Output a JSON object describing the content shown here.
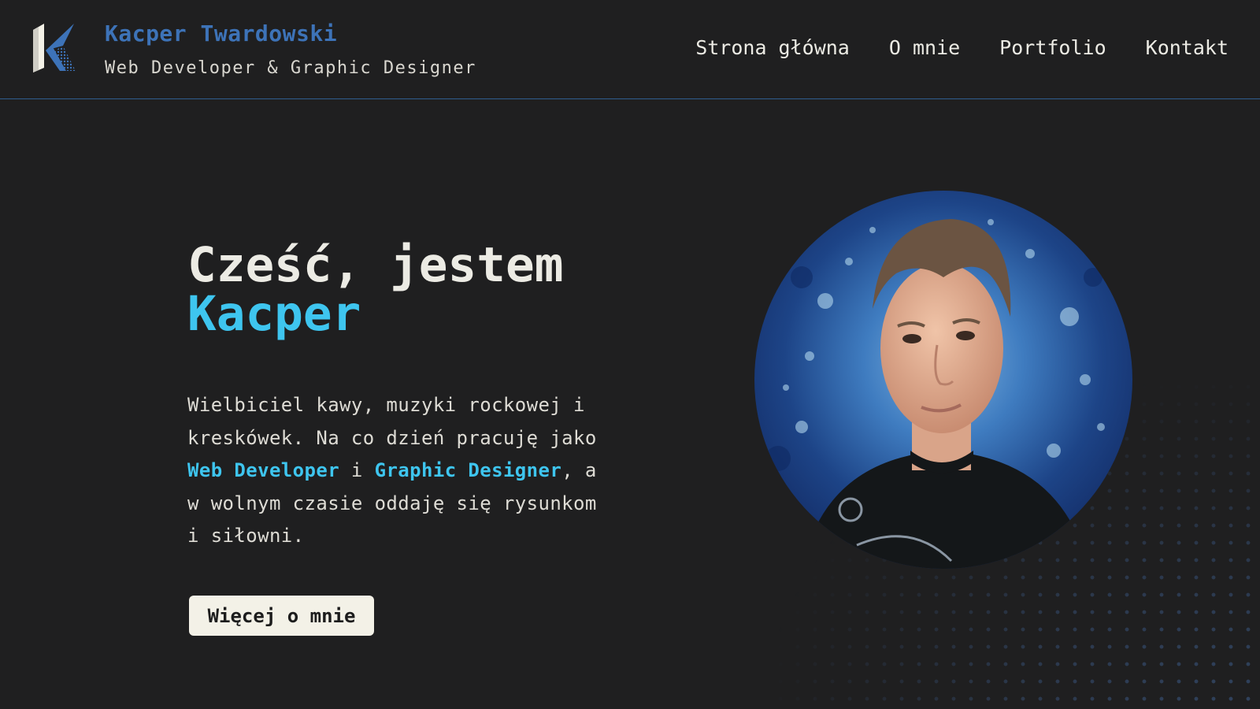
{
  "header": {
    "brand_name": "Kacper Twardowski",
    "brand_tagline": "Web Developer & Graphic Designer",
    "logo_icon": "k-monogram-logo-icon",
    "nav": [
      {
        "label": "Strona główna"
      },
      {
        "label": "O mnie"
      },
      {
        "label": "Portfolio"
      },
      {
        "label": "Kontakt"
      }
    ]
  },
  "hero": {
    "title_line1": "Cześć, jestem",
    "title_name": "Kacper",
    "text_part1": "Wielbiciel kawy, muzyki rockowej i kreskówek. Na co dzień pracuję jako ",
    "text_hl1": "Web Developer",
    "text_part2": " i ",
    "text_hl2": "Graphic Designer",
    "text_part3": ", a w wolnym czasie oddaję się rysunkom i siłowni.",
    "button_label": "Więcej o mnie",
    "portrait_icon": "profile-photo"
  },
  "colors": {
    "background": "#1f1f20",
    "accent_blue": "#3d73b8",
    "accent_cyan": "#3ec5ef",
    "text_light": "#ecebe4",
    "button_bg": "#f3f1e7"
  }
}
